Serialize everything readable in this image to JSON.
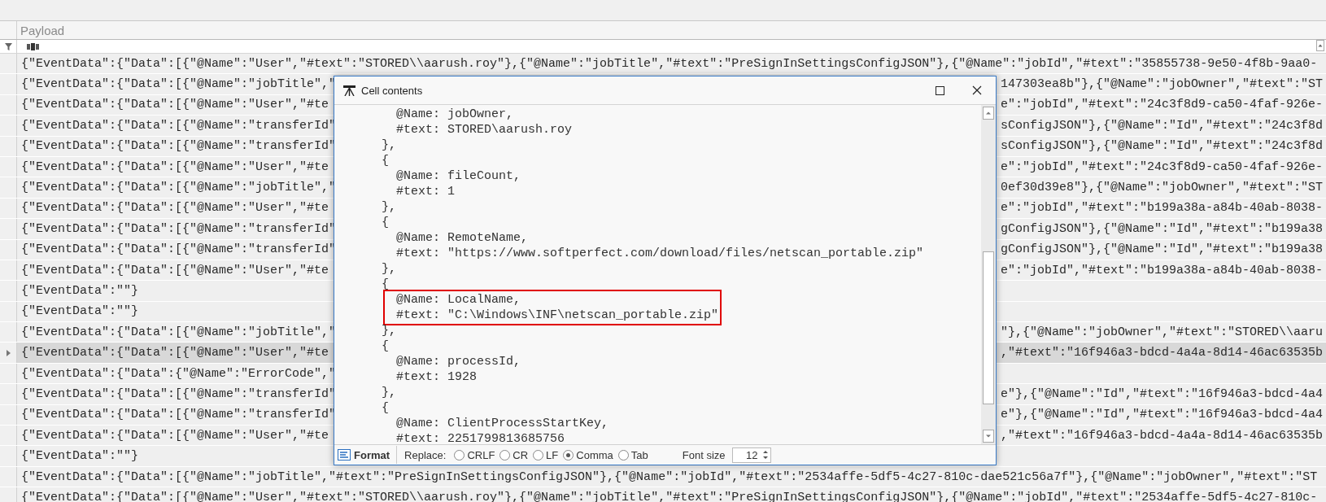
{
  "grid": {
    "columns": [
      {
        "header": "Payload"
      }
    ],
    "rows": [
      {
        "text": "{\"EventData\":{\"Data\":[{\"@Name\":\"User\",\"#text\":\"STORED\\\\aarush.roy\"},{\"@Name\":\"jobTitle\",\"#text\":\"PreSignInSettingsConfigJSON\"},{\"@Name\":\"jobId\",\"#text\":\"35855738-9e50-4f8b-9aa0-",
        "current": false
      },
      {
        "text": "{\"EventData\":{\"Data\":[{\"@Name\":\"jobTitle\",\"",
        "text_right": "147303ea8b\"},{\"@Name\":\"jobOwner\",\"#text\":\"ST",
        "current": false
      },
      {
        "text": "{\"EventData\":{\"Data\":[{\"@Name\":\"User\",\"#te",
        "text_right": "e\":\"jobId\",\"#text\":\"24c3f8d9-ca50-4faf-926e-",
        "current": false
      },
      {
        "text": "{\"EventData\":{\"Data\":[{\"@Name\":\"transferId\"",
        "text_right": "sConfigJSON\"},{\"@Name\":\"Id\",\"#text\":\"24c3f8d",
        "current": false
      },
      {
        "text": "{\"EventData\":{\"Data\":[{\"@Name\":\"transferId\"",
        "text_right": "sConfigJSON\"},{\"@Name\":\"Id\",\"#text\":\"24c3f8d",
        "current": false
      },
      {
        "text": "{\"EventData\":{\"Data\":[{\"@Name\":\"User\",\"#te",
        "text_right": "e\":\"jobId\",\"#text\":\"24c3f8d9-ca50-4faf-926e-",
        "current": false
      },
      {
        "text": "{\"EventData\":{\"Data\":[{\"@Name\":\"jobTitle\",\"",
        "text_right": "0ef30d39e8\"},{\"@Name\":\"jobOwner\",\"#text\":\"ST",
        "current": false
      },
      {
        "text": "{\"EventData\":{\"Data\":[{\"@Name\":\"User\",\"#te",
        "text_right": "e\":\"jobId\",\"#text\":\"b199a38a-a84b-40ab-8038-",
        "current": false
      },
      {
        "text": "{\"EventData\":{\"Data\":[{\"@Name\":\"transferId\"",
        "text_right": "gConfigJSON\"},{\"@Name\":\"Id\",\"#text\":\"b199a38",
        "current": false
      },
      {
        "text": "{\"EventData\":{\"Data\":[{\"@Name\":\"transferId\"",
        "text_right": "gConfigJSON\"},{\"@Name\":\"Id\",\"#text\":\"b199a38",
        "current": false
      },
      {
        "text": "{\"EventData\":{\"Data\":[{\"@Name\":\"User\",\"#te",
        "text_right": "e\":\"jobId\",\"#text\":\"b199a38a-a84b-40ab-8038-",
        "current": false
      },
      {
        "text": "{\"EventData\":\"\"}",
        "current": false
      },
      {
        "text": "{\"EventData\":\"\"}",
        "current": false
      },
      {
        "text": "{\"EventData\":{\"Data\":[{\"@Name\":\"jobTitle\",\"",
        "text_right": "\"},{\"@Name\":\"jobOwner\",\"#text\":\"STORED\\\\aaru",
        "current": false
      },
      {
        "text": "{\"EventData\":{\"Data\":[{\"@Name\":\"User\",\"#te",
        "text_right": ",\"#text\":\"16f946a3-bdcd-4a4a-8d14-46ac63535b",
        "current": true
      },
      {
        "text": "{\"EventData\":{\"Data\":{\"@Name\":\"ErrorCode\",\"",
        "current": false
      },
      {
        "text": "{\"EventData\":{\"Data\":[{\"@Name\":\"transferId\"",
        "text_right": "e\"},{\"@Name\":\"Id\",\"#text\":\"16f946a3-bdcd-4a4",
        "current": false
      },
      {
        "text": "{\"EventData\":{\"Data\":[{\"@Name\":\"transferId\"",
        "text_right": "e\"},{\"@Name\":\"Id\",\"#text\":\"16f946a3-bdcd-4a4",
        "current": false
      },
      {
        "text": "{\"EventData\":{\"Data\":[{\"@Name\":\"User\",\"#te",
        "text_right": ",\"#text\":\"16f946a3-bdcd-4a4a-8d14-46ac63535b",
        "current": false
      },
      {
        "text": "{\"EventData\":\"\"}",
        "current": false
      },
      {
        "text": "{\"EventData\":{\"Data\":[{\"@Name\":\"jobTitle\",\"#text\":\"PreSignInSettingsConfigJSON\"},{\"@Name\":\"jobId\",\"#text\":\"2534affe-5df5-4c27-810c-dae521c56a7f\"},{\"@Name\":\"jobOwner\",\"#text\":\"ST",
        "current": false
      },
      {
        "text": "{\"EventData\":{\"Data\":[{\"@Name\":\"User\",\"#text\":\"STORED\\\\aarush.roy\"},{\"@Name\":\"jobTitle\",\"#text\":\"PreSignInSettingsConfigJSON\"},{\"@Name\":\"jobId\",\"#text\":\"2534affe-5df5-4c27-810c-",
        "current": false
      }
    ]
  },
  "dialog": {
    "title": "Cell contents",
    "lines": [
      {
        "text": "      @Name: jobOwner,",
        "highlighted": false
      },
      {
        "text": "      #text: STORED\\aarush.roy",
        "highlighted": false
      },
      {
        "text": "    },",
        "highlighted": false
      },
      {
        "text": "    {",
        "highlighted": false
      },
      {
        "text": "      @Name: fileCount,",
        "highlighted": false
      },
      {
        "text": "      #text: 1",
        "highlighted": false
      },
      {
        "text": "    },",
        "highlighted": false
      },
      {
        "text": "    {",
        "highlighted": false
      },
      {
        "text": "      @Name: RemoteName,",
        "highlighted": false
      },
      {
        "text": "      #text: \"https://www.softperfect.com/download/files/netscan_portable.zip\"",
        "highlighted": false
      },
      {
        "text": "    },",
        "highlighted": false
      },
      {
        "text": "    {",
        "highlighted": false
      },
      {
        "text": "      @Name: LocalName,",
        "highlighted": true
      },
      {
        "text": "      #text: \"C:\\Windows\\INF\\netscan_portable.zip\"",
        "highlighted": true
      },
      {
        "text": "    },",
        "highlighted": false
      },
      {
        "text": "    {",
        "highlighted": false
      },
      {
        "text": "      @Name: processId,",
        "highlighted": false
      },
      {
        "text": "      #text: 1928",
        "highlighted": false
      },
      {
        "text": "    },",
        "highlighted": false
      },
      {
        "text": "    {",
        "highlighted": false
      },
      {
        "text": "      @Name: ClientProcessStartKey,",
        "highlighted": false
      },
      {
        "text": "      #text: 2251799813685756",
        "highlighted": false
      }
    ],
    "format_button": "Format",
    "replace_label": "Replace:",
    "replace_options": [
      {
        "label": "CRLF",
        "selected": false
      },
      {
        "label": "CR",
        "selected": false
      },
      {
        "label": "LF",
        "selected": false
      },
      {
        "label": "Comma",
        "selected": true
      },
      {
        "label": "Tab",
        "selected": false
      }
    ],
    "font_size_label": "Font size",
    "font_size": "12"
  }
}
